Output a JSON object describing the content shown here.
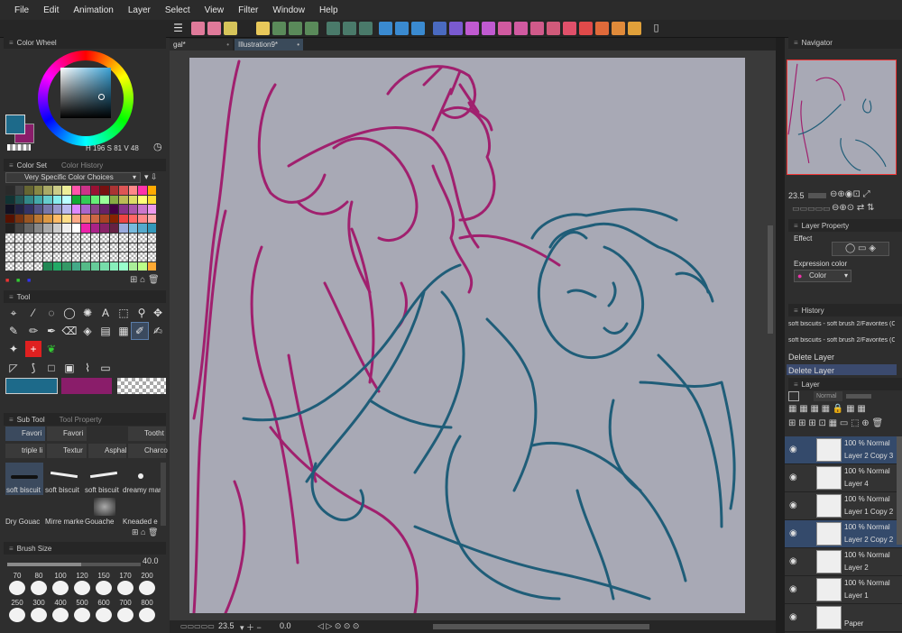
{
  "menu": [
    "File",
    "Edit",
    "Animation",
    "Layer",
    "Select",
    "View",
    "Filter",
    "Window",
    "Help"
  ],
  "tabs": [
    "gal*",
    "Illustration9*"
  ],
  "color_wheel": {
    "title": "Color Wheel",
    "h": "196",
    "s": "81",
    "v": "48",
    "h_label": "H",
    "s_label": "S",
    "v_label": "V",
    "main_color": "#1d6a8a",
    "sub_color": "#8a1d6a"
  },
  "color_set": {
    "title": "Color Set",
    "tab2": "Color History",
    "selected_set": "Very Specific Color Choices"
  },
  "tool_panel": {
    "title": "Tool"
  },
  "sub_tool": {
    "title": "Sub Tool",
    "tab2": "Tool Property",
    "groups": [
      "Favori",
      "Favori",
      "Tootht",
      "triple li",
      "Textur",
      "Asphal",
      "Charco"
    ],
    "brushes": [
      "soft biscuit",
      "soft biscuit",
      "soft biscuit",
      "dreamy mar"
    ],
    "brushes2": [
      "Dry Gouac",
      "Mirre marke",
      "Gouache",
      "Kneaded e"
    ]
  },
  "brush_size": {
    "title": "Brush Size",
    "value": "40.0",
    "sizes_row1": [
      "70",
      "80",
      "100",
      "120",
      "150",
      "170",
      "200"
    ],
    "sizes_row2": [
      "250",
      "300",
      "400",
      "500",
      "600",
      "700",
      "800"
    ]
  },
  "status": {
    "zoom": "23.5",
    "angle": "0.0"
  },
  "navigator": {
    "title": "Navigator",
    "zoom": "23.5"
  },
  "layer_property": {
    "title": "Layer Property",
    "effect_label": "Effect",
    "expression_label": "Expression color",
    "expression_value": "Color"
  },
  "history": {
    "title": "History",
    "items": [
      "soft biscuits - soft brush 2/Favorites (Cr...",
      "soft biscuits - soft brush 2/Favorites (Cr...",
      "Delete Layer",
      "Delete Layer"
    ]
  },
  "layer_panel": {
    "title": "Layer",
    "blend": "Normal",
    "layers": [
      {
        "opacity": "100 % Normal",
        "name": "Layer 2 Copy 3",
        "selected": true
      },
      {
        "opacity": "100 % Normal",
        "name": "Layer 4",
        "selected": false
      },
      {
        "opacity": "100 % Normal",
        "name": "Layer 1 Copy 2",
        "selected": false
      },
      {
        "opacity": "100 % Normal",
        "name": "Layer 2 Copy 2",
        "selected": true
      },
      {
        "opacity": "100 % Normal",
        "name": "Layer 2",
        "selected": false
      },
      {
        "opacity": "100 % Normal",
        "name": "Layer 1",
        "selected": false
      },
      {
        "opacity": "",
        "name": "Paper",
        "selected": false
      }
    ]
  },
  "colors": {
    "magenta_line": "#a0206e",
    "teal_line": "#1f5d78",
    "canvas_bg": "#a8a9b5"
  }
}
